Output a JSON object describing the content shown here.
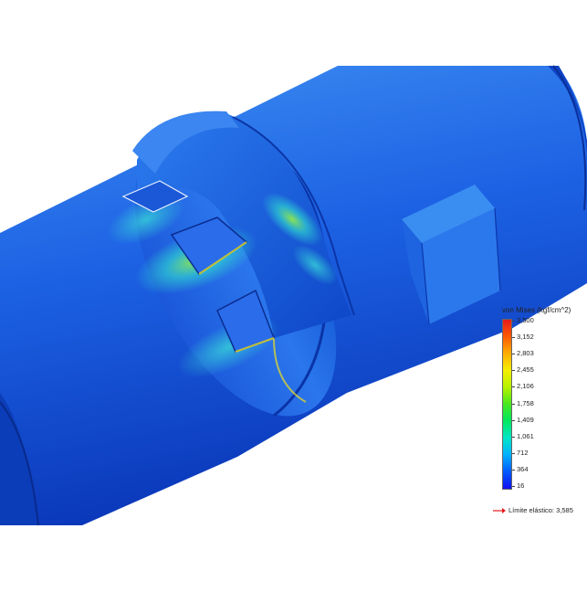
{
  "legend": {
    "title": "von Mises (kgf/cm^2)",
    "ticks": [
      "3,500",
      "3,152",
      "2,803",
      "2,455",
      "2,106",
      "1,758",
      "1,409",
      "1,061",
      "712",
      "364",
      "16"
    ],
    "colors": [
      "#e41a1c",
      "#ff5a00",
      "#ffae00",
      "#f5ef00",
      "#b6f200",
      "#46e820",
      "#00e860",
      "#00e6c8",
      "#00b0ff",
      "#005aff",
      "#1010f0"
    ],
    "yield_label": "Límite elástico: 3,585",
    "yield_arrow_color": "#e41a1c"
  },
  "model": {
    "colors": {
      "shaft": "#1a5ee0",
      "shaft_dark": "#0d3fbf",
      "shaft_light": "#3b8af0",
      "hot_cyan": "#28e0d8",
      "hot_green": "#8af030",
      "hot_yellow": "#f0e020"
    }
  }
}
